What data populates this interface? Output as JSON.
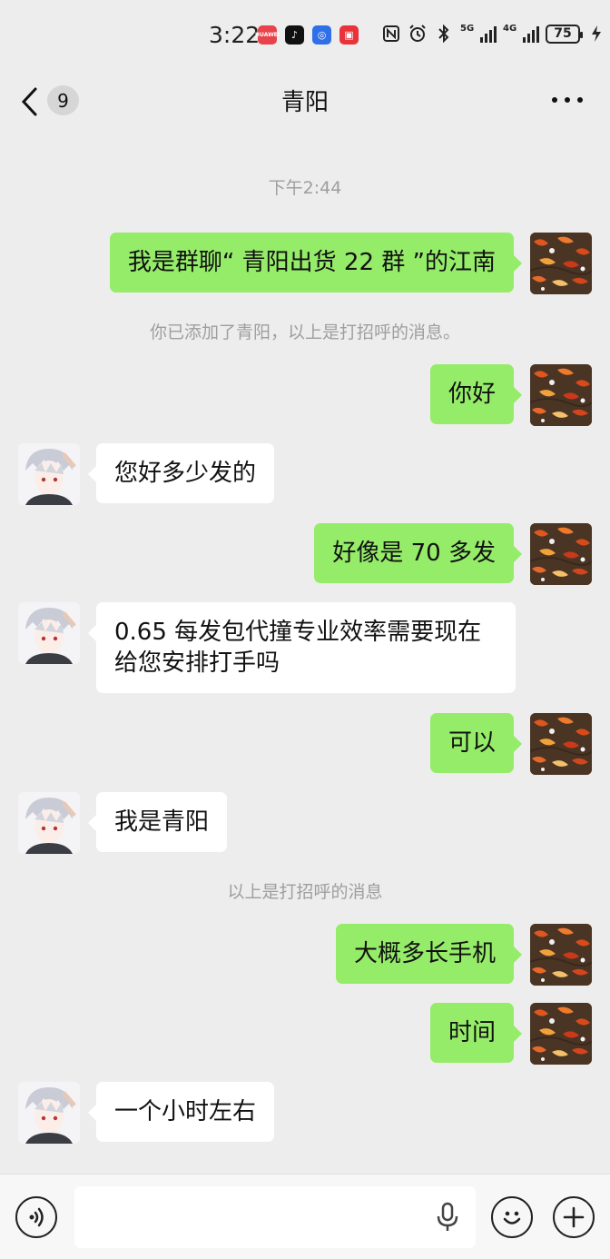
{
  "status_bar": {
    "time": "3:22",
    "apps": [
      {
        "name": "huawei-store-icon",
        "label": "HUAWEI",
        "color": "#e8424a"
      },
      {
        "name": "tiktok-icon",
        "label": "♪",
        "color": "#111111"
      },
      {
        "name": "blue-app-icon",
        "label": "◎",
        "color": "#2f6fe8"
      },
      {
        "name": "red-app-icon",
        "label": "▣",
        "color": "#e8333a"
      }
    ],
    "network_a": "5G",
    "network_b": "4G",
    "battery": "75"
  },
  "header": {
    "title": "青阳",
    "unread_count": "9"
  },
  "chat": {
    "timestamp": "下午2:44",
    "notice_added": "你已添加了青阳，以上是打招呼的消息。",
    "notice_greeting": "以上是打招呼的消息",
    "messages": [
      {
        "side": "me",
        "text": "我是群聊“ 青阳出货 22 群 ”的江南"
      },
      {
        "side": "me",
        "text": "你好"
      },
      {
        "side": "peer",
        "text": "您好多少发的"
      },
      {
        "side": "me",
        "text": "好像是 70 多发"
      },
      {
        "side": "peer",
        "line1": "0.65 每发包代撞专业效率需要现在",
        "line2": "给您安排打手吗"
      },
      {
        "side": "me",
        "text": "可以"
      },
      {
        "side": "peer",
        "text": "我是青阳"
      },
      {
        "side": "me",
        "text": "大概多长手机"
      },
      {
        "side": "me",
        "text": "时间"
      },
      {
        "side": "peer",
        "text": "一个小时左右"
      }
    ]
  },
  "input_bar": {
    "value": "",
    "placeholder": ""
  },
  "colors": {
    "background": "#ededed",
    "my_bubble": "#95ec69",
    "peer_bubble": "#ffffff",
    "system_text": "#9e9e9e"
  }
}
